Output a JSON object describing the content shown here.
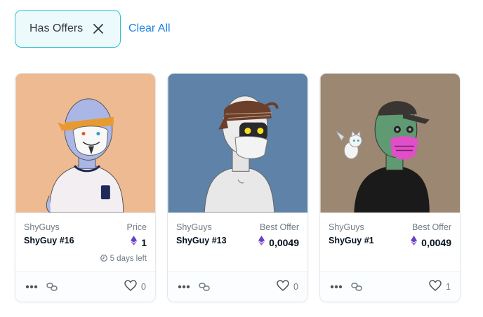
{
  "filters": {
    "chip_label": "Has Offers",
    "clear_all_label": "Clear All"
  },
  "colors": {
    "accent": "#2081e2",
    "chip_border": "#2dc1d1",
    "eth_purple": "#6b3fc4"
  },
  "cards": [
    {
      "background": "#eeba92",
      "collection": "ShyGuys",
      "name": "ShyGuy #16",
      "price_label": "Price",
      "price": "1",
      "time_left": "5 days left",
      "likes": "0"
    },
    {
      "background": "#5e82a8",
      "collection": "ShyGuys",
      "name": "ShyGuy #13",
      "price_label": "Best Offer",
      "price": "0,0049",
      "likes": "0"
    },
    {
      "background": "#9c8772",
      "collection": "ShyGuys",
      "name": "ShyGuy #1",
      "price_label": "Best Offer",
      "price": "0,0049",
      "likes": "1"
    }
  ],
  "icons": {
    "close": "close-icon",
    "eth": "ethereum-icon",
    "clock": "clock-icon",
    "more": "more-icon",
    "link": "link-icon",
    "heart": "heart-icon"
  }
}
